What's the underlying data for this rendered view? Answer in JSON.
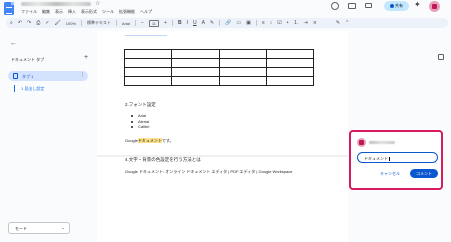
{
  "menubar": [
    "ファイル",
    "編集",
    "表示",
    "挿入",
    "表示形式",
    "ツール",
    "拡張機能",
    "ヘルプ"
  ],
  "toolbar": {
    "zoom": "100%",
    "style": "標準テキスト",
    "font": "Arial",
    "font_size": "11"
  },
  "header": {
    "share_label": "共有"
  },
  "left_panel": {
    "title": "ドキュメント タブ",
    "tab_label": "タブ 1",
    "heading_item": "1 見出し設定",
    "mode_label": "モード"
  },
  "document": {
    "sec2_heading": "2.フォント設定",
    "font_list": [
      "Arial",
      "Alerial",
      "Calibri"
    ],
    "sentence_prefix": "Google",
    "sentence_highlight": "ドキュメント",
    "sentence_suffix": "です。",
    "sec3_heading": "4.文字・背景の色設定を行う方法とは",
    "link_line": "Google ドキュメント: オンライン ドキュメント エディタ | PDF エディタ | Google Workspace"
  },
  "comment": {
    "input_value": "ドキュメント",
    "cancel_label": "キャンセル",
    "submit_label": "コメント"
  },
  "colors": {
    "accent": "#0b57d0",
    "highlight": "#fbe18a",
    "comment_border": "#d81b60"
  }
}
